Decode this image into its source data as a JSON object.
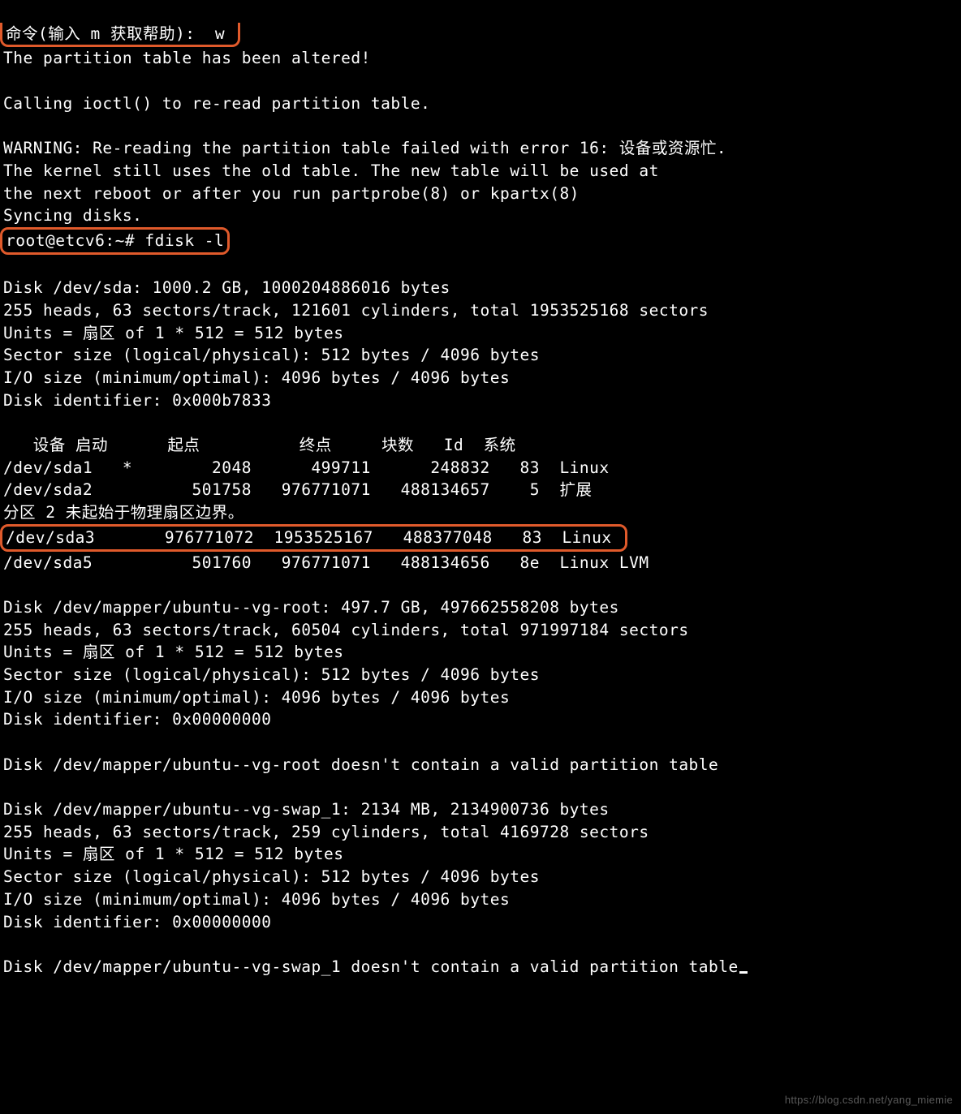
{
  "prompt_line": "命令(输入 m 获取帮助):  w ",
  "altered": "The partition table has been altered!",
  "calling": "Calling ioctl() to re-read partition table.",
  "warning1": "WARNING: Re-reading the partition table failed with error 16: 设备或资源忙.",
  "warning2": "The kernel still uses the old table. The new table will be used at",
  "warning3": "the next reboot or after you run partprobe(8) or kpartx(8)",
  "syncing": "Syncing disks.",
  "shell_prompt": "root@etcv6:~# fdisk -l",
  "sda_header": "Disk /dev/sda: 1000.2 GB, 1000204886016 bytes",
  "sda_geom": "255 heads, 63 sectors/track, 121601 cylinders, total 1953525168 sectors",
  "sda_units": "Units = 扇区 of 1 * 512 = 512 bytes",
  "sda_sect": "Sector size (logical/physical): 512 bytes / 4096 bytes",
  "sda_io": "I/O size (minimum/optimal): 4096 bytes / 4096 bytes",
  "sda_id": "Disk identifier: 0x000b7833",
  "table_head": "   设备 启动      起点          终点     块数   Id  系统",
  "row_sda1": "/dev/sda1   *        2048      499711      248832   83  Linux",
  "row_sda2": "/dev/sda2          501758   976771071   488134657    5  扩展",
  "note_phys": "分区 2 未起始于物理扇区边界。",
  "row_sda3": "/dev/sda3       976771072  1953525167   488377048   83  Linux ",
  "row_sda5": "/dev/sda5          501760   976771071   488134656   8e  Linux LVM",
  "vg_root_header": "Disk /dev/mapper/ubuntu--vg-root: 497.7 GB, 497662558208 bytes",
  "vg_root_geom": "255 heads, 63 sectors/track, 60504 cylinders, total 971997184 sectors",
  "vg_root_units": "Units = 扇区 of 1 * 512 = 512 bytes",
  "vg_root_sect": "Sector size (logical/physical): 512 bytes / 4096 bytes",
  "vg_root_io": "I/O size (minimum/optimal): 4096 bytes / 4096 bytes",
  "vg_root_id": "Disk identifier: 0x00000000",
  "vg_root_err": "Disk /dev/mapper/ubuntu--vg-root doesn't contain a valid partition table",
  "swap_header": "Disk /dev/mapper/ubuntu--vg-swap_1: 2134 MB, 2134900736 bytes",
  "swap_geom": "255 heads, 63 sectors/track, 259 cylinders, total 4169728 sectors",
  "swap_units": "Units = 扇区 of 1 * 512 = 512 bytes",
  "swap_sect": "Sector size (logical/physical): 512 bytes / 4096 bytes",
  "swap_io": "I/O size (minimum/optimal): 4096 bytes / 4096 bytes",
  "swap_id": "Disk identifier: 0x00000000",
  "swap_err": "Disk /dev/mapper/ubuntu--vg-swap_1 doesn't contain a valid partition table",
  "watermark": "https://blog.csdn.net/yang_miemie"
}
